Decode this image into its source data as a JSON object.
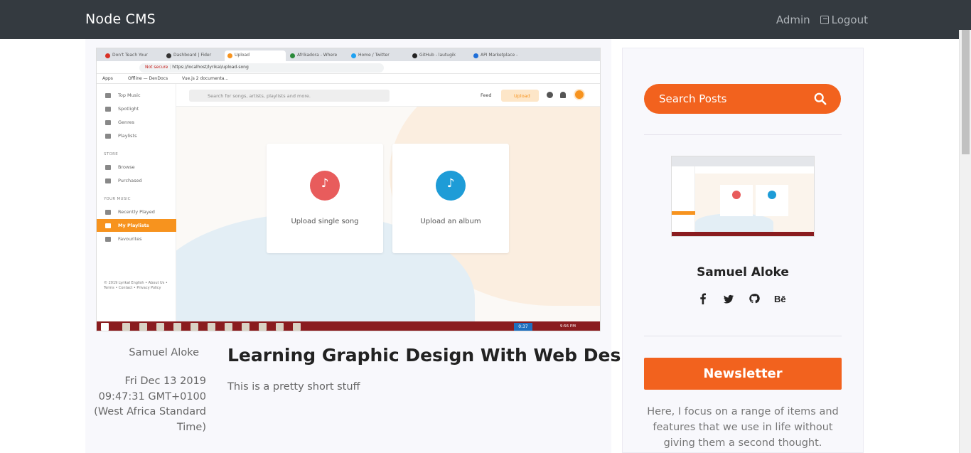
{
  "navbar": {
    "brand": "Node CMS",
    "admin_label": "Admin",
    "logout_label": "Logout"
  },
  "post": {
    "author": "Samuel Aloke",
    "date": "Fri Dec 13 2019 09:47:31 GMT+0100 (West Africa Standard Time)",
    "title": "Learning Graphic Design With Web Design",
    "excerpt": "This is a pretty short stuff"
  },
  "screenshot": {
    "tabs": [
      "Don't Teach Your",
      "Dashboard | Fider",
      "Upload",
      "Afrikadora - Where",
      "Home / Twitter",
      "GitHub - lautugik",
      "API Marketplace - "
    ],
    "address_prefix": "Not secure",
    "address_url": "https://localhost/lyrikal/upload-song",
    "bookmarks": [
      "Apps",
      "Offline — DevDocs",
      "Vue.js 2 documenta..."
    ],
    "app_search_placeholder": "Search for songs, artists, playlists and more.",
    "feed_label": "Feed",
    "upload_label": "Upload",
    "sidebar_items": [
      "Top Music",
      "Spotlight",
      "Genres",
      "Playlists"
    ],
    "store_heading": "STORE",
    "store_items": [
      "Browse",
      "Purchased"
    ],
    "music_heading": "YOUR MUSIC",
    "music_items": [
      "Recently Played",
      "My Playlists",
      "Favourites"
    ],
    "footer": "© 2019 Lyrikal   English • About Us • Terms • Contact • Privacy Policy",
    "card_single": "Upload single song",
    "card_album": "Upload an album",
    "taskbar_clock": "0:37",
    "taskbar_time": "9:56 PM"
  },
  "sidebar": {
    "search_label": "Search Posts",
    "author_name": "Samuel Aloke",
    "social_icons": [
      "facebook-icon",
      "twitter-icon",
      "github-icon",
      "behance-icon"
    ],
    "newsletter_label": "Newsletter",
    "newsletter_text": "Here, I focus on a range of items and features that we use in life without giving them a second thought."
  },
  "colors": {
    "navbar": "#343a40",
    "accent": "#f2621e",
    "app_accent": "#f7931e",
    "card_red": "#e85c5c",
    "card_blue": "#1e9cd7"
  }
}
